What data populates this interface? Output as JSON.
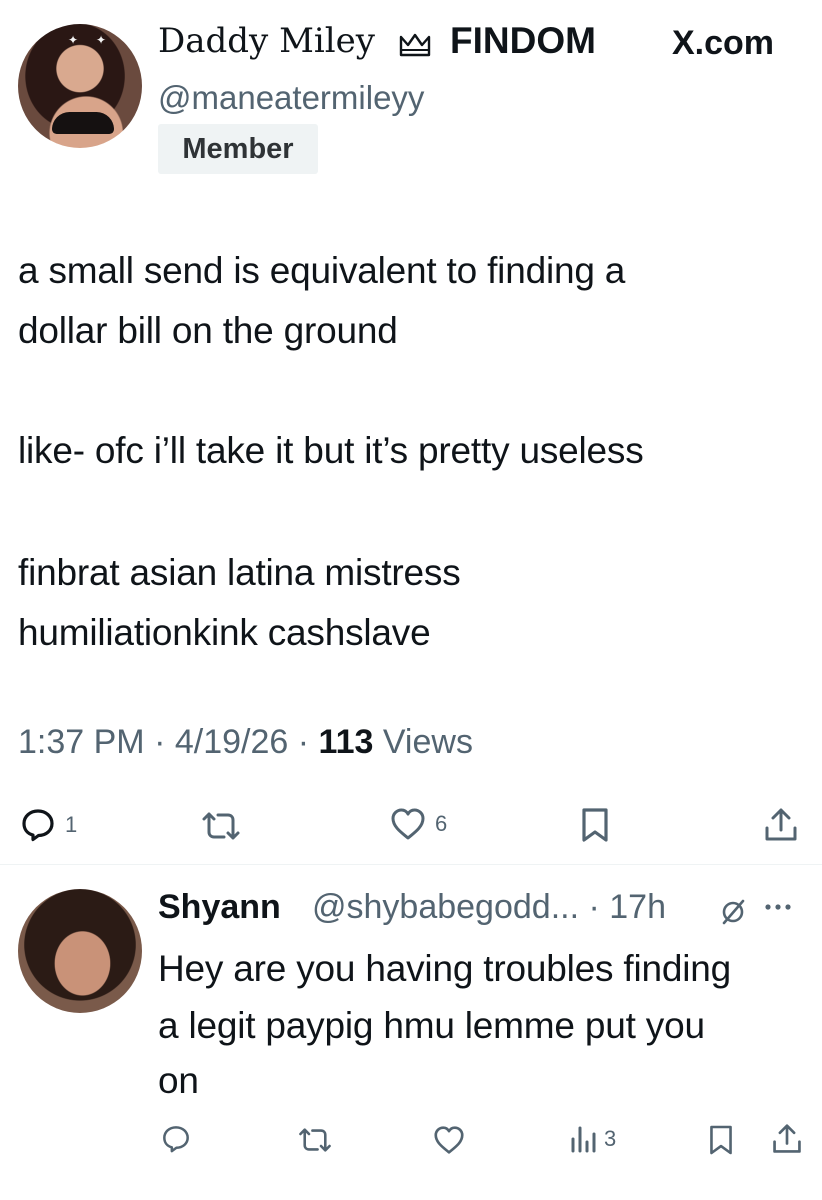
{
  "post": {
    "author": {
      "display_name": "Daddy Miley",
      "display_tag": "FINDOM",
      "handle": "@maneatermileyy",
      "badge": "Member"
    },
    "brand": "X.com",
    "text_lines": [
      "a small send is equivalent to finding a",
      "dollar bill on the ground",
      "like- ofc i’ll take it but it’s pretty useless",
      "finbrat asian latina mistress",
      "humiliationkink cashslave"
    ],
    "time": "1:37 PM",
    "date": "4/19/26",
    "separator": "·",
    "views_count": "113",
    "views_label": "Views",
    "actions": {
      "reply_count": "1",
      "like_count": "6"
    }
  },
  "reply": {
    "name": "Shyann",
    "handle_time": "@shybabegodd... · 17h",
    "text_lines": [
      "Hey are you having troubles finding",
      "a legit paypig hmu lemme put you",
      "on"
    ],
    "views_count": "3"
  },
  "icons": {
    "reply": "comment-bubble-icon",
    "retweet": "retweet-icon",
    "like": "heart-icon",
    "bookmark": "bookmark-icon",
    "share": "share-icon",
    "analytics": "bar-chart-icon",
    "grok": "grok-icon",
    "more": "more-dots-icon",
    "verified_tag": "crown-icon"
  },
  "colors": {
    "text": "#0f1419",
    "secondary": "#536471",
    "badge_bg": "#eff3f4"
  }
}
